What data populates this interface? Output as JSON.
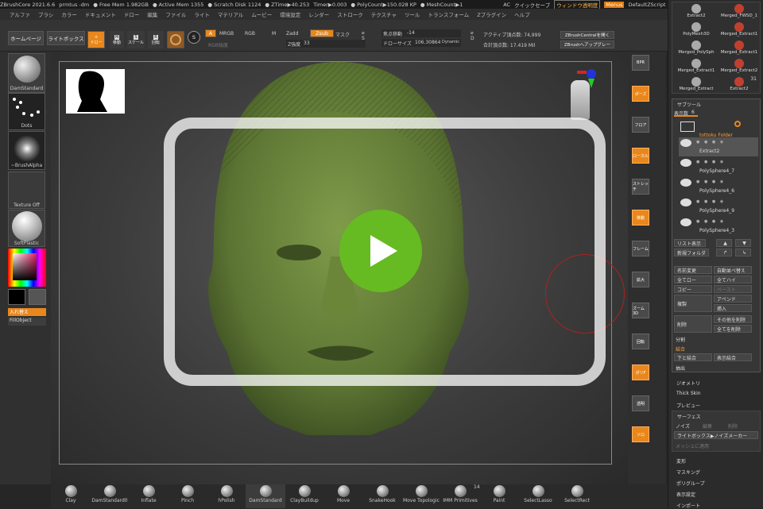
{
  "titlebar": {
    "app": "ZBrushCore 2021.6.6",
    "doc": "prmtus -dm",
    "free_mem": "● Free Mem 1.982GB",
    "active_mem": "● Active Mem 1355",
    "scratch": "● Scratch Disk 1124",
    "ztime": "● ZTime▶40.253",
    "timer": "Timer▶0.003",
    "polycount": "● PolyCount▶150.028 KP",
    "meshcount": "● MeshCount▶1",
    "ac": "AC",
    "quicksave": "クイックセーブ",
    "window_transparency": "ウィンドウ透明度",
    "menus": "Menus",
    "script": "DefaultZScript"
  },
  "menubar": [
    "アルファ",
    "ブラシ",
    "カラー",
    "ドキュメント",
    "ドロー",
    "編集",
    "ファイル",
    "ライト",
    "マテリアル",
    "ムービー",
    "環境設定",
    "レンダー",
    "ストローク",
    "テクスチャ",
    "ツール",
    "トランスフォーム",
    "Zプラグイン",
    "ヘルプ"
  ],
  "toolbar": {
    "home": "ホームページ",
    "lightbox": "ライトボックス",
    "draw": "ドロー",
    "move": "移動",
    "scale": "スケール",
    "rotate": "回転",
    "a": "A",
    "mrgb": "MRGB",
    "rgb": "RGB",
    "m": "M",
    "zadd": "Zadd",
    "zsub": "Zsub",
    "mask": "マスク",
    "rgb_intensity": "RGB強度",
    "z_intensity_label": "Z強度",
    "z_intensity": "33",
    "focal_shift_label": "焦点移動",
    "focal_shift": "-14",
    "draw_size_label": "ドローサイズ",
    "draw_size": "106.30864",
    "dynamic": "Dynamic",
    "s": "S",
    "d": "D",
    "active_points": "アクティブ頂点数: 74,999",
    "total_points": "合計頂点数: 17.419 Mil",
    "zbrush_central": "ZBrushCentralを開く",
    "zbrush_upgrade": "ZBrushへアップグレー"
  },
  "leftshelf": {
    "brush": "DamStandard",
    "stroke": "Dots",
    "alpha": "~BrushAlpha",
    "texture": "Texture Off",
    "material": "SoftPlastic",
    "swap": "入れ替え",
    "fill": "FillObject"
  },
  "rightshelf": [
    "BPR",
    "ポーズ",
    "フロア",
    "ローカル",
    "ストレッチ",
    "移動",
    "フレーム",
    "拡大",
    "ズーム3D",
    "回転",
    "ポリF",
    "透明",
    "ソロ"
  ],
  "rpanel": {
    "top_items": [
      "Extract2",
      "Merged_FWSD_1",
      "PolyMesh3D",
      "Merged_Extract1",
      "Merged_PolySph",
      "Merged_Extract1",
      "Merged_Extract1",
      "Merged_Extract2",
      "Merged_Extract",
      "Extract2"
    ],
    "badge": "31",
    "subtool": "サブツール",
    "display_count_label": "表示数",
    "display_count": "6",
    "folder": "tottoku Folder",
    "subtools": [
      "Extract2",
      "PolySphere4_7",
      "PolySphere4_6",
      "PolySphere4_9",
      "PolySphere4_3"
    ],
    "list_view": "リスト表示",
    "new_folder": "新規フォルダ",
    "rename": "名前変更",
    "autosort": "自動並べ替え",
    "all_low": "全てロー",
    "all_high": "全てハイ",
    "copy": "コピー",
    "paste": "ペースト",
    "append": "アペンド",
    "duplicate": "複製",
    "insert": "挿入",
    "delete": "削除",
    "delete_other": "その他を削除",
    "delete_all": "全てを削除",
    "split": "分割",
    "merge": "結合",
    "merge_down": "下と結合",
    "merge_visible": "表示結合",
    "extract": "抽出",
    "geometry": "ジオメトリ",
    "thick_skin": "Thick Skin",
    "preview": "プレビュー",
    "surface": "サーフェス",
    "noise": "ノイズ",
    "edit": "編集",
    "remove": "削除",
    "lightbox_noise": "ライトボックス▶ノイズメーカー",
    "apply_mesh": "メッシュに適用",
    "deformation": "変形",
    "masking": "マスキング",
    "polygroups": "ポリグループ",
    "display": "表示設定",
    "import": "インポート"
  },
  "bottom_brushes": [
    "Clay",
    "DamStandard0",
    "Inflate",
    "Pinch",
    "hPolish",
    "DamStandard",
    "ClayBuildup",
    "Move",
    "SnakeHook",
    "Move Topologic",
    "IMM Primitives",
    "Paint",
    "SelectLasso",
    "SelectRect"
  ],
  "imm_count": "14",
  "colors": {
    "accent": "#e8871c",
    "play": "#66bb22",
    "mesh": "#6e8a3f"
  }
}
